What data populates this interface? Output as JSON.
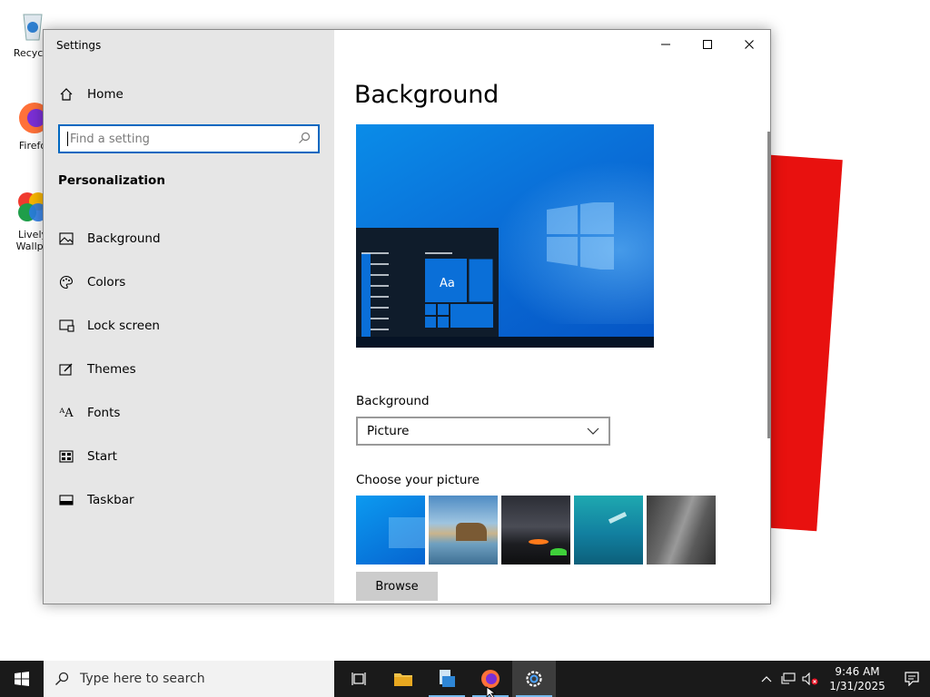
{
  "desktop": {
    "icons": [
      {
        "label": "Recycle",
        "icon": "recycle-bin-icon"
      },
      {
        "label": "Firefo",
        "icon": "firefox-icon"
      },
      {
        "label": "Lively Wallpa",
        "icon": "lively-wallpaper-icon"
      }
    ]
  },
  "window": {
    "title": "Settings",
    "controls": {
      "minimize": "—",
      "maximize": "☐",
      "close": "✕"
    }
  },
  "sidebar": {
    "home_label": "Home",
    "search_placeholder": "Find a setting",
    "section_title": "Personalization",
    "items": [
      {
        "label": "Background",
        "icon": "background-icon"
      },
      {
        "label": "Colors",
        "icon": "palette-icon"
      },
      {
        "label": "Lock screen",
        "icon": "lock-screen-icon"
      },
      {
        "label": "Themes",
        "icon": "themes-icon"
      },
      {
        "label": "Fonts",
        "icon": "fonts-icon"
      },
      {
        "label": "Start",
        "icon": "start-icon"
      },
      {
        "label": "Taskbar",
        "icon": "taskbar-icon"
      }
    ]
  },
  "main": {
    "title": "Background",
    "preview_tile_label": "Aa",
    "background_label": "Background",
    "background_value": "Picture",
    "choose_label": "Choose your picture",
    "thumbnails": [
      "windows-blue",
      "beach-rocks",
      "night-sky",
      "underwater-swimmer",
      "rock-cliff"
    ],
    "browse_label": "Browse"
  },
  "taskbar": {
    "search_placeholder": "Type here to search",
    "apps": [
      "task-view",
      "file-explorer",
      "file-manager",
      "firefox",
      "settings"
    ],
    "time": "9:46 AM",
    "date": "1/31/2025"
  },
  "colors": {
    "accent": "#0067c0",
    "sidebar_bg": "#e6e6e6",
    "taskbar_bg": "#1a1a1a",
    "red_card": "#e8110f"
  }
}
